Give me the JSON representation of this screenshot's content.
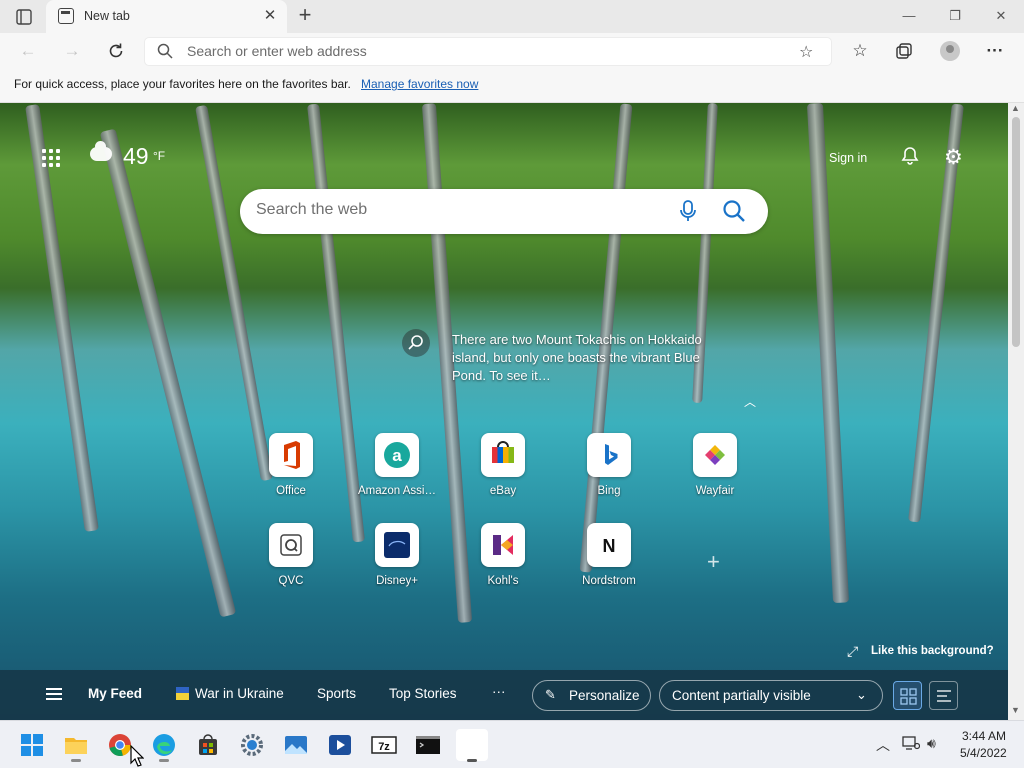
{
  "browser": {
    "tab_title": "New tab",
    "new_tab_symbol": "+",
    "tab_close_symbol": "✕",
    "window_buttons": [
      "—",
      "❐",
      "✕"
    ],
    "address_placeholder": "Search or enter web address"
  },
  "favorites_bar": {
    "message": "For quick access, place your favorites here on the favorites bar.",
    "link": "Manage favorites now"
  },
  "newtab": {
    "weather": {
      "temp": "49",
      "unit": "°F"
    },
    "sign_in": "Sign in",
    "search_placeholder": "Search the web",
    "bg_caption": "There are two Mount Tokachis on Hokkaido island, but only one boasts the vibrant Blue Pond. To see it…",
    "quick_links": [
      {
        "label": "Office",
        "icon": "office-icon"
      },
      {
        "label": "Amazon Assi…",
        "icon": "amazon-icon"
      },
      {
        "label": "eBay",
        "icon": "ebay-icon"
      },
      {
        "label": "Bing",
        "icon": "bing-icon"
      },
      {
        "label": "Wayfair",
        "icon": "wayfair-icon"
      },
      {
        "label": "QVC",
        "icon": "qvc-icon"
      },
      {
        "label": "Disney+",
        "icon": "disney-plus-icon"
      },
      {
        "label": "Kohl's",
        "icon": "kohls-icon"
      },
      {
        "label": "Nordstrom",
        "icon": "nordstrom-icon"
      }
    ],
    "like_background": "Like this background?",
    "feed": {
      "my_feed": "My Feed",
      "war_in_ukraine": "War in Ukraine",
      "sports": "Sports",
      "top_stories": "Top Stories",
      "more": "···",
      "personalize": "Personalize",
      "content_visibility": "Content partially visible"
    }
  },
  "taskbar": {
    "apps": [
      "start-icon",
      "file-explorer-icon",
      "chrome-icon",
      "edge-icon",
      "microsoft-store-icon",
      "settings-icon",
      "photos-icon",
      "media-player-icon",
      "7zip-icon",
      "terminal-icon",
      "blank-app-icon"
    ],
    "time": "3:44 AM",
    "date": "5/4/2022"
  }
}
